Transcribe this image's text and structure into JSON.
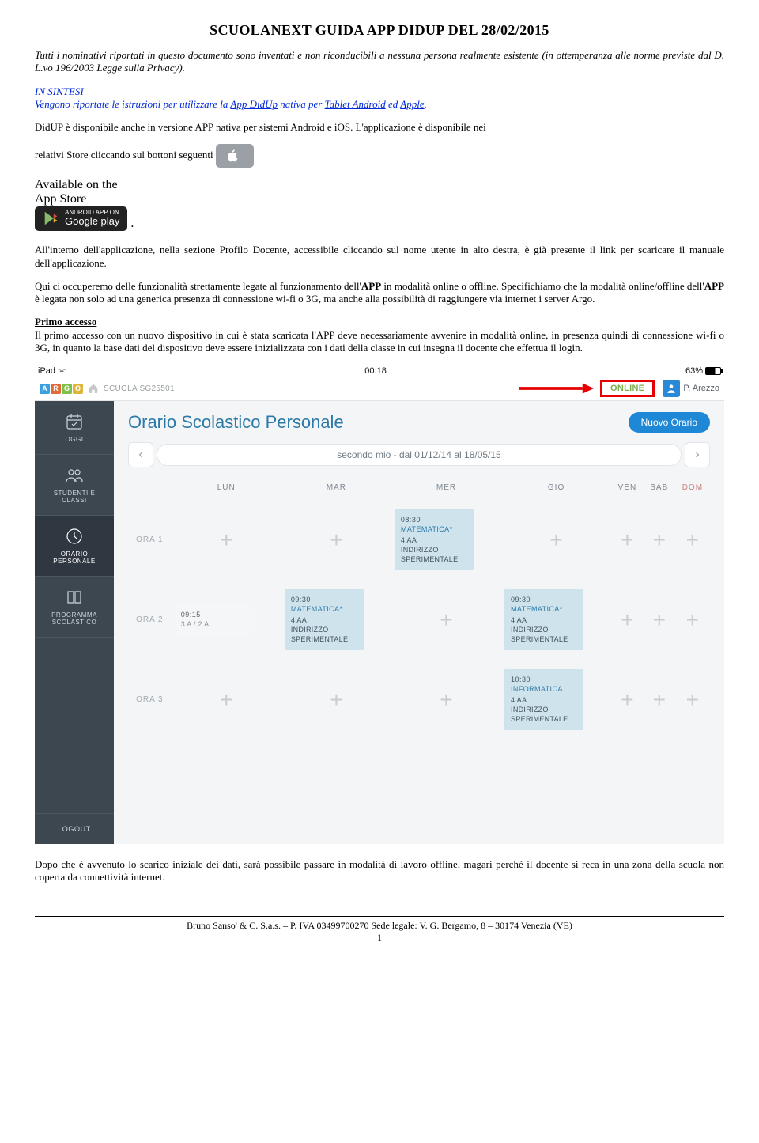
{
  "title_u": "SCUOLANEXT GUIDA APP DIDUP",
  "title_plain": " DEL 28/02/2015",
  "intro": "Tutti i nominativi riportati in questo documento sono inventati e non riconducibili a nessuna persona realmente esistente (in ottemperanza alle norme previste dal D. L.vo 196/2003 Legge sulla Privacy).",
  "sintesi_head": "IN SINTESI",
  "sintesi_l1": "Vengono riportate le istruzioni per utilizzare la ",
  "sintesi_app": "App DidUp",
  "sintesi_l2": " nativa per ",
  "sintesi_t1": "Tablet Android",
  "sintesi_l3": " ed ",
  "sintesi_t2": "Apple",
  "sintesi_dot": ".",
  "p1a": "DidUP è disponibile anche in versione APP nativa per sistemi Android e iOS. L'applicazione è disponibile nei",
  "p1b": "relativi Store cliccando sul bottoni seguenti ",
  "store_app_t1": "Available on the",
  "store_app_t2": "App Store",
  "store_gp_t1": "ANDROID APP ON",
  "store_gp_t2": "Google play",
  "p1c": "All'interno dell'applicazione, nella sezione Profilo Docente, accessibile cliccando sul nome utente in alto destra, è già presente il link per scaricare il manuale dell'applicazione.",
  "p1d": "Qui ci occuperemo delle funzionalità strettamente legate al funzionamento dell'",
  "p1d_b": "APP",
  "p1d2": " in modalità online o offline. Specifichiamo che la modalità online/offline dell'",
  "p1d_b2": "APP",
  "p1d3": " è legata non solo ad una generica presenza di connessione wi-fi o 3G, ma anche alla possibilità di raggiungere via internet i server Argo.",
  "sec2_head": "Primo accesso",
  "sec2": "Il primo accesso con un nuovo dispositivo in cui è stata scaricata l'APP deve necessariamente avvenire in modalità online, in presenza quindi di connessione wi-fi o 3G, in quanto la base dati del dispositivo deve essere inizializzata con i dati della classe in cui insegna il docente che effettua il login.",
  "ios_l": "iPad ᯤ",
  "ios_c": "00:18",
  "ios_r": "63%",
  "argo": [
    "A",
    "R",
    "G",
    "O"
  ],
  "argo_colors": [
    "#3aa0e0",
    "#e06a3a",
    "#7fbf4a",
    "#e0b63a"
  ],
  "school": "SCUOLA SG25501",
  "online": "ONLINE",
  "user": "P. Arezzo",
  "side": [
    "OGGI",
    "STUDENTI E\nCLASSI",
    "ORARIO\nPERSONALE",
    "PROGRAMMA\nSCOLASTICO"
  ],
  "logout": "LOGOUT",
  "panel_title": "Orario Scolastico Personale",
  "new_btn": "Nuovo Orario",
  "period": "secondo mio - dal 01/12/14 al 18/05/15",
  "days": [
    "LUN",
    "MAR",
    "MER",
    "GIO",
    "VEN",
    "SAB",
    "DOM"
  ],
  "rows": [
    "ORA 1",
    "ORA 2",
    "ORA 3"
  ],
  "cells": {
    "r1c3": {
      "time": "08:30",
      "subj": "MATEMATICA*",
      "cls": "4 AA\nINDIRIZZO\nSPERIMENTALE"
    },
    "r2c1": {
      "time": "09:15",
      "cls": "3 A / 2 A"
    },
    "r2c2": {
      "time": "09:30",
      "subj": "MATEMATICA*",
      "cls": "4 AA\nINDIRIZZO\nSPERIMENTALE"
    },
    "r2c4": {
      "time": "09:30",
      "subj": "MATEMATICA*",
      "cls": "4 AA\nINDIRIZZO\nSPERIMENTALE"
    },
    "r3c4": {
      "time": "10:30",
      "subj": "INFORMATICA",
      "cls": "4 AA\nINDIRIZZO\nSPERIMENTALE"
    }
  },
  "post": "Dopo che è avvenuto lo scarico iniziale dei dati, sarà possibile passare in modalità di lavoro offline, magari perché il docente si reca in una zona della scuola non coperta da connettività internet.",
  "footer": "Bruno Sanso' & C. S.a.s. – P. IVA 03499700270 Sede legale: V. G. Bergamo, 8 – 30174 Venezia (VE)",
  "pgno": "1"
}
